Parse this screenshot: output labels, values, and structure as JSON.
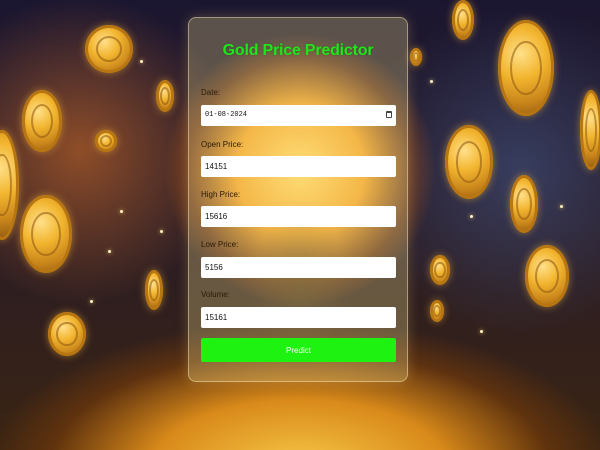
{
  "app": {
    "title": "Gold Price Predictor"
  },
  "form": {
    "date": {
      "label": "Date:",
      "value": "01-08-2024",
      "icon": "calendar-icon"
    },
    "open_price": {
      "label": "Open Price:",
      "value": "14151"
    },
    "high_price": {
      "label": "High Price:",
      "value": "15616"
    },
    "low_price": {
      "label": "Low Price:",
      "value": "5156"
    },
    "volume": {
      "label": "Volume:",
      "value": "15161"
    },
    "submit_label": "Predict"
  },
  "colors": {
    "title": "#1fe51a",
    "button": "#1ef210",
    "button_text": "#ffffff"
  }
}
